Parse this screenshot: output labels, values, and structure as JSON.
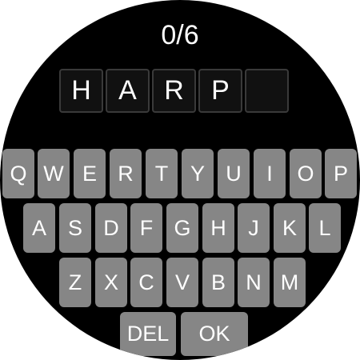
{
  "score": "0/6",
  "guess": [
    "H",
    "A",
    "R",
    "P",
    ""
  ],
  "keyboard": {
    "row1": [
      "Q",
      "W",
      "E",
      "R",
      "T",
      "Y",
      "U",
      "I",
      "O",
      "P"
    ],
    "row2": [
      "A",
      "S",
      "D",
      "F",
      "G",
      "H",
      "J",
      "K",
      "L"
    ],
    "row3": [
      "Z",
      "X",
      "C",
      "V",
      "B",
      "N",
      "M"
    ],
    "del_label": "DEL",
    "ok_label": "OK"
  },
  "colors": {
    "background": "#000000",
    "key": "#868686",
    "tile_border": "#3a3a3a",
    "text": "#ffffff"
  }
}
